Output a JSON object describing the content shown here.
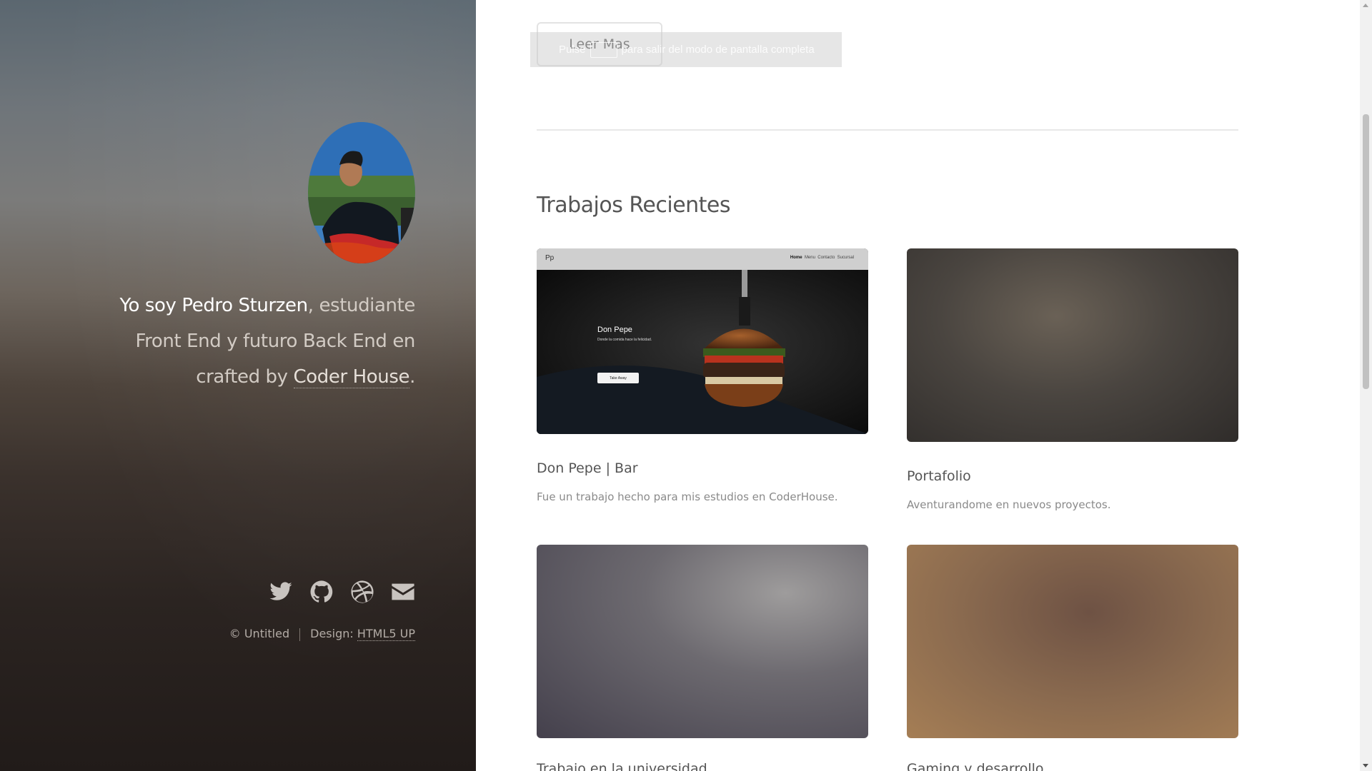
{
  "sidebar": {
    "intro": {
      "strong": "Yo soy Pedro Sturzen",
      "rest_before_link": ", estudiante Front End y futuro Back End en crafted by ",
      "link": "Coder House",
      "end": "."
    },
    "social": [
      "twitter-icon",
      "github-icon",
      "dribbble-icon",
      "envelope-icon"
    ],
    "copyright": "© Untitled",
    "design_label": "Design: ",
    "design_link": "HTML5 UP"
  },
  "main": {
    "read_more_label": "Leer Mas",
    "fullscreen_notice": {
      "before": "Pulse",
      "after": "para salir del modo de pantalla completa"
    },
    "section_title": "Trabajos Recientes",
    "works": [
      {
        "title": "Don Pepe | Bar",
        "description": "Fue un trabajo hecho para mis estudios en CoderHouse.",
        "preview": {
          "logo": "Pp",
          "nav": [
            "Home",
            "Menu",
            "Contacto",
            "Sucursal"
          ],
          "heading": "Don Pepe",
          "subheading": "Donde la comida hace la felicidad.",
          "button": "Take Away"
        }
      },
      {
        "title": "Portafolio",
        "description": "Aventurandome en nuevos proyectos."
      },
      {
        "title": "Trabajo en la universidad"
      },
      {
        "title": "Gaming y desarrollo"
      }
    ]
  },
  "colors": {
    "accent_text": "#555555",
    "muted_text": "#8a8a8a",
    "sidebar_text": "#d2cbc4"
  }
}
